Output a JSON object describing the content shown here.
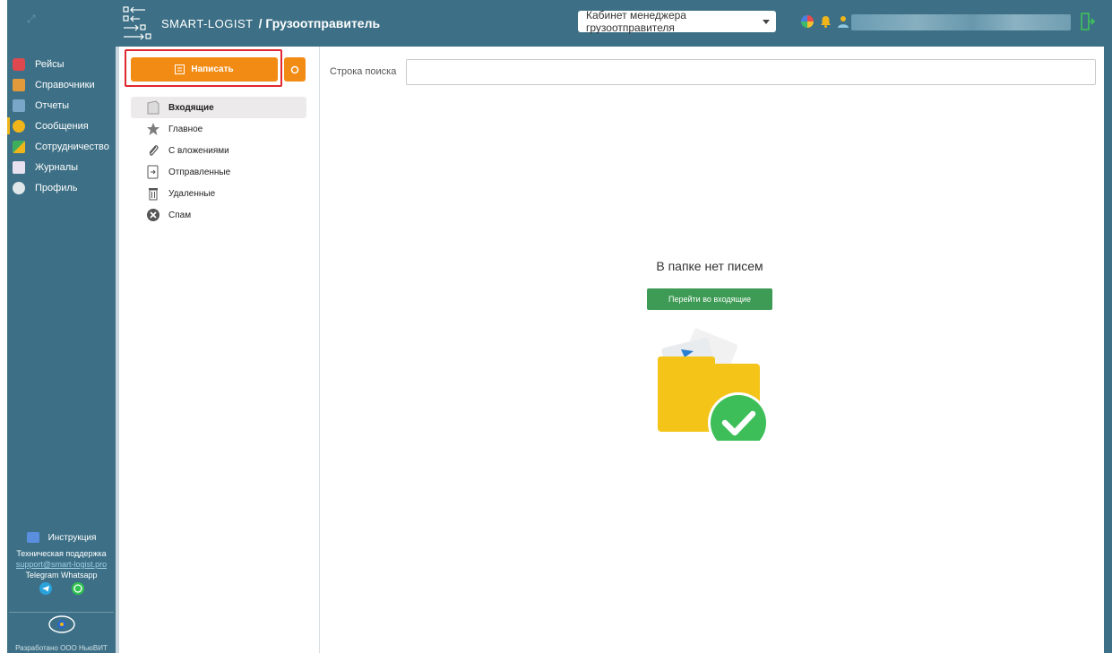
{
  "app": {
    "brand": "SMART-LOGIST",
    "section": "/ Грузоотправитель"
  },
  "header": {
    "cabinet_select": "Кабинет менеджера грузоотправителя"
  },
  "sidebar": {
    "items": [
      {
        "label": "Рейсы",
        "icon": "trucks-icon",
        "color": "#e0484f"
      },
      {
        "label": "Справочники",
        "icon": "book-icon",
        "color": "#e39a3a"
      },
      {
        "label": "Отчеты",
        "icon": "chart-icon",
        "color": "#7aa7c7"
      },
      {
        "label": "Сообщения",
        "icon": "envelope-icon",
        "color": "#f0b51a"
      },
      {
        "label": "Сотрудничество",
        "icon": "handshake-icon",
        "color": "#3fae5c"
      },
      {
        "label": "Журналы",
        "icon": "journal-icon",
        "color": "#e8e1f0"
      },
      {
        "label": "Профиль",
        "icon": "user-icon",
        "color": "#dfe7ea"
      }
    ],
    "footer": {
      "instruction": "Инструкция",
      "support_title": "Техническая поддержка",
      "support_email": "support@smart-logist.pro",
      "messengers": "Telegram  Whatsapp",
      "partner_logo": "NEWVIT",
      "developer": "Разработано ООО НьюВИТ"
    }
  },
  "messages": {
    "compose_label": "Написать",
    "folders": [
      {
        "label": "Входящие",
        "icon": "inbox-icon"
      },
      {
        "label": "Главное",
        "icon": "star-icon"
      },
      {
        "label": "С вложениями",
        "icon": "paperclip-icon"
      },
      {
        "label": "Отправленные",
        "icon": "sent-icon"
      },
      {
        "label": "Удаленные",
        "icon": "trash-icon"
      },
      {
        "label": "Спам",
        "icon": "spam-icon"
      }
    ]
  },
  "main": {
    "search_label": "Строка поиска",
    "search_value": "",
    "empty_text": "В папке нет писем",
    "go_inbox_label": "Перейти во входящие"
  },
  "colors": {
    "header_bg": "#3d7086",
    "accent_orange": "#f28b14",
    "success_green": "#3e9b55",
    "highlight_red": "#e0282e"
  }
}
